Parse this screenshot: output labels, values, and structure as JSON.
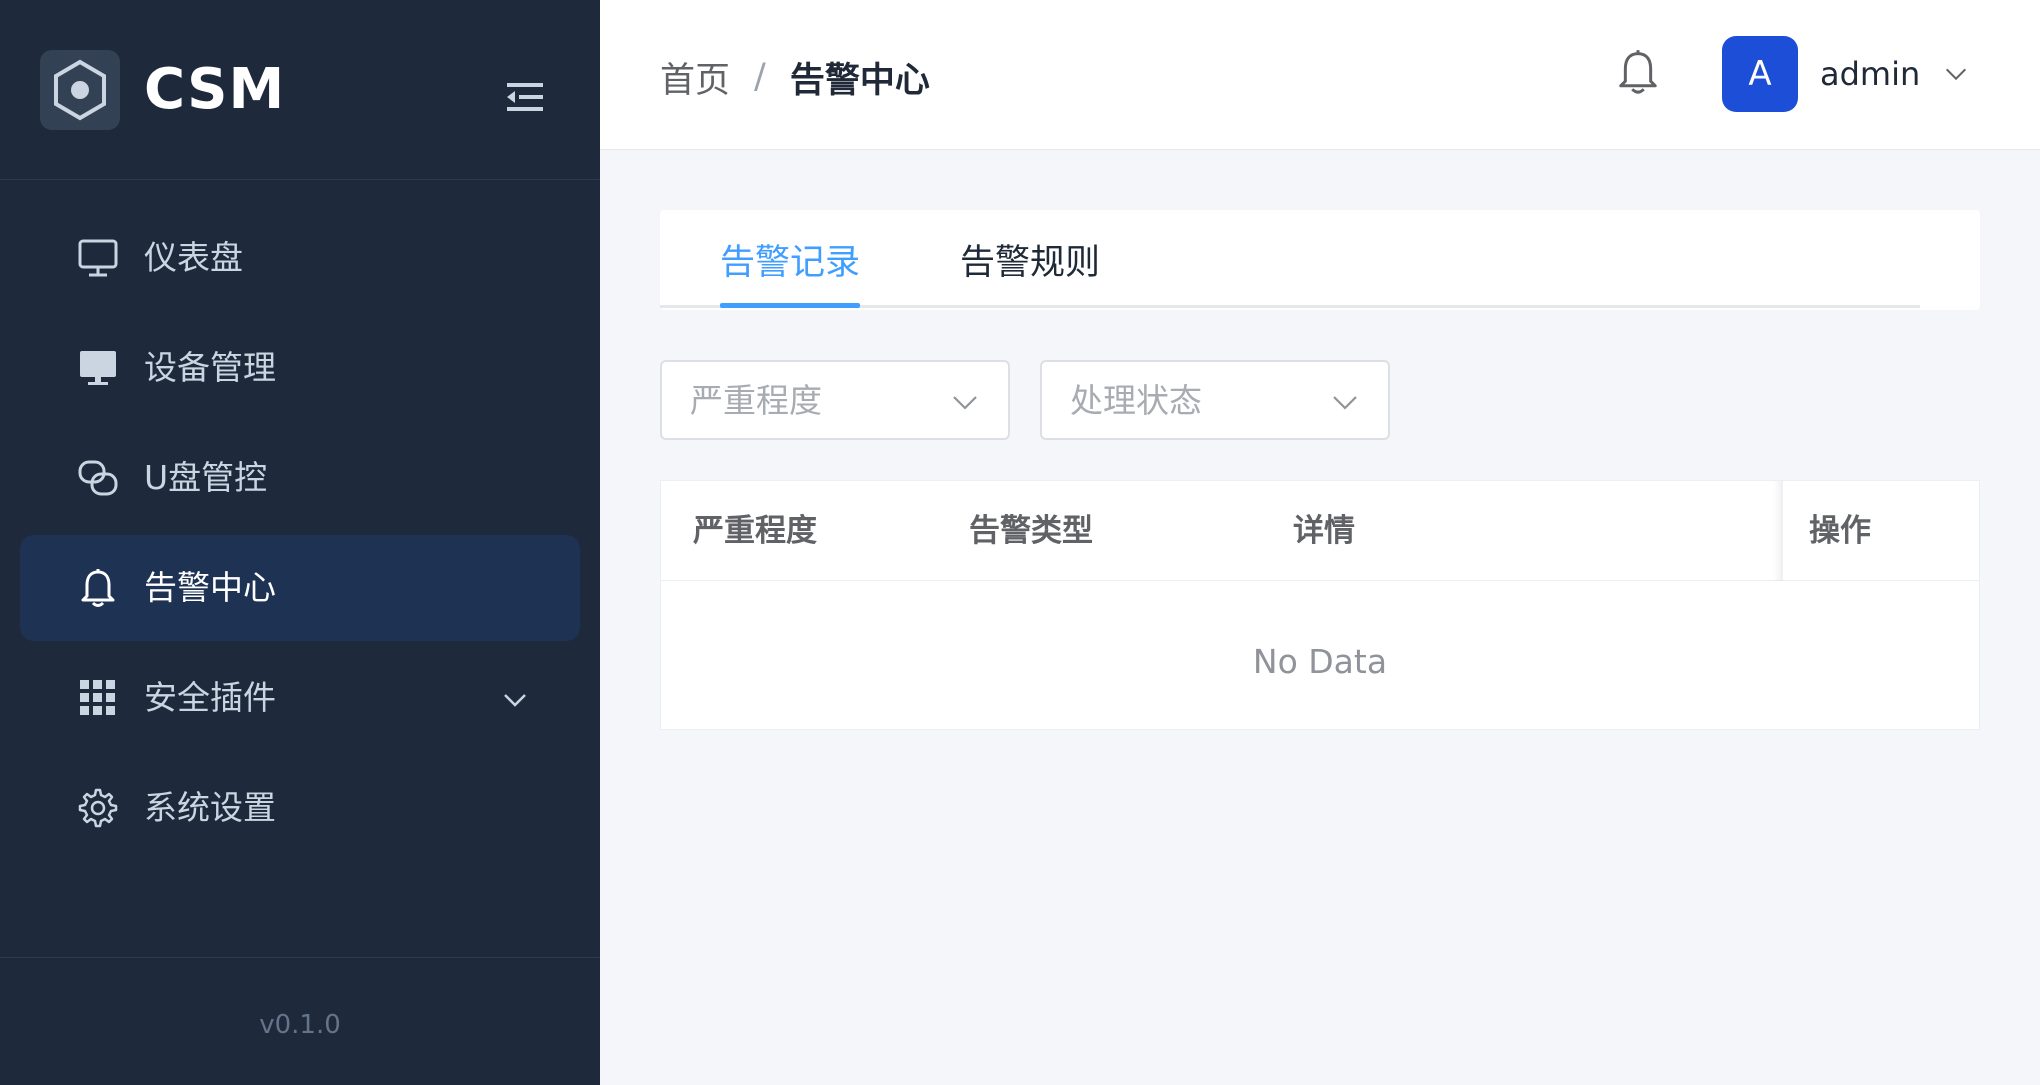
{
  "brand": {
    "name": "CSM"
  },
  "sidebar": {
    "items": [
      {
        "label": "仪表盘",
        "icon": "monitor-outline-icon",
        "active": false
      },
      {
        "label": "设备管理",
        "icon": "monitor-filled-icon",
        "active": false
      },
      {
        "label": "U盘管控",
        "icon": "link-icon",
        "active": false
      },
      {
        "label": "告警中心",
        "icon": "bell-icon",
        "active": true
      },
      {
        "label": "安全插件",
        "icon": "grid-icon",
        "active": false,
        "expandable": true
      },
      {
        "label": "系统设置",
        "icon": "gear-icon",
        "active": false
      }
    ],
    "version": "v0.1.0"
  },
  "header": {
    "breadcrumb": {
      "home": "首页",
      "separator": "/",
      "current": "告警中心"
    },
    "user": {
      "avatar_letter": "A",
      "name": "admin"
    }
  },
  "tabs": [
    {
      "label": "告警记录",
      "active": true
    },
    {
      "label": "告警规则",
      "active": false
    }
  ],
  "filters": {
    "severity_placeholder": "严重程度",
    "status_placeholder": "处理状态"
  },
  "table": {
    "columns": [
      "严重程度",
      "告警类型",
      "详情",
      "操作"
    ],
    "rows": [],
    "empty_text": "No Data"
  },
  "colors": {
    "sidebar_bg": "#1e293b",
    "accent": "#409eff",
    "avatar_bg": "#1d4ed8"
  }
}
